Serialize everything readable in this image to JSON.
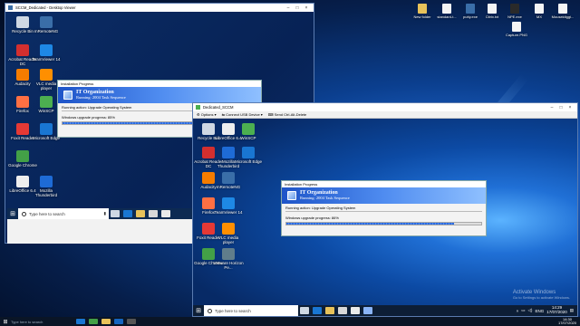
{
  "host_desktop": {
    "right_icons": [
      {
        "label": "New folder",
        "color": "#e8c25a"
      },
      {
        "label": "standard-t...",
        "color": "#f4f4f4"
      },
      {
        "label": "putty.exe",
        "color": "#3a6ea8"
      },
      {
        "label": "Citrix.txt",
        "color": "#f4f4f4"
      },
      {
        "label": "NPE.exe",
        "color": "#2a2a2a"
      },
      {
        "label": "MX",
        "color": "#f4f4f4"
      },
      {
        "label": "Mouseidiggi...",
        "color": "#f4f4f4"
      },
      {
        "label": "Capture.PNG",
        "color": "#f4f4f4"
      }
    ],
    "watermark_title": "Activate Windows",
    "watermark_sub": "Go to Settings to activate Windows."
  },
  "rdp_window": {
    "title": "SCCM_Dedicated - Desktop Viewer",
    "icons": [
      {
        "label": "Recycle Bin",
        "color": "#cfd8e3"
      },
      {
        "label": "mRemoteNG",
        "color": "#3a6ea8"
      },
      {
        "label": "Acrobat Reader DC",
        "color": "#d32f2f"
      },
      {
        "label": "TeamViewer 14",
        "color": "#1e88e5"
      },
      {
        "label": "Audacity",
        "color": "#f57c00"
      },
      {
        "label": "VLC media player",
        "color": "#ff8f00"
      },
      {
        "label": "Firefox",
        "color": "#ff7043"
      },
      {
        "label": "WinSCP",
        "color": "#4caf50"
      },
      {
        "label": "Foxit Reader",
        "color": "#e53935"
      },
      {
        "label": "Microsoft Edge",
        "color": "#1976d2"
      },
      {
        "label": "Google Chrome",
        "color": "#43a047"
      },
      {
        "label": "LibreOffice 6.4",
        "color": "#eeeeee"
      },
      {
        "label": "Mozilla Thunderbird",
        "color": "#1e6bd6"
      }
    ],
    "dialog": {
      "header": "Installation Progress",
      "org": "IT Organization",
      "seq": "Running: 2004 Task Sequence",
      "action": "Running action: Upgrade Operating System",
      "progress_label": "Windows upgrade progress: 85%",
      "progress": 0.85
    },
    "search_placeholder": "Type here to search"
  },
  "vm_window": {
    "title": "Dedicated_SCCM",
    "toolbar": [
      "Options",
      "Connect USB Device",
      "Send Ctrl-Alt-Delete"
    ],
    "icons": [
      {
        "label": "Recycle Bin",
        "color": "#cfd8e3"
      },
      {
        "label": "LibreOffice 6.4",
        "color": "#eeeeee"
      },
      {
        "label": "WinSCP",
        "color": "#4caf50"
      },
      {
        "label": "Acrobat Reader DC",
        "color": "#d32f2f"
      },
      {
        "label": "Mozilla Thunderbird",
        "color": "#1e6bd6"
      },
      {
        "label": "Microsoft Edge",
        "color": "#1976d2"
      },
      {
        "label": "Audacity",
        "color": "#f57c00"
      },
      {
        "label": "mRemoteNG",
        "color": "#3a6ea8"
      },
      {
        "label": "Firefox",
        "color": "#ff7043"
      },
      {
        "label": "TeamViewer 14",
        "color": "#1e88e5"
      },
      {
        "label": "Foxit Reader",
        "color": "#e53935"
      },
      {
        "label": "VLC media player",
        "color": "#ff8f00"
      },
      {
        "label": "Google Chrome",
        "color": "#43a047"
      },
      {
        "label": "VMware Horizon Pe...",
        "color": "#607d8b"
      }
    ],
    "dialog": {
      "header": "Installation Progress",
      "org": "IT Organization",
      "seq": "Running: 2004 Task Sequence",
      "action": "Running action: Upgrade Operating System",
      "progress_label": "Windows upgrade progress: 86%",
      "progress": 0.86
    },
    "search_placeholder": "Type here to search",
    "clock_time": "14:29",
    "clock_date": "17/07/2020",
    "lang": "ENG"
  },
  "host_taskbar": {
    "search_placeholder": "Type here to search",
    "time": "14:30",
    "date": "17/07/2020"
  }
}
